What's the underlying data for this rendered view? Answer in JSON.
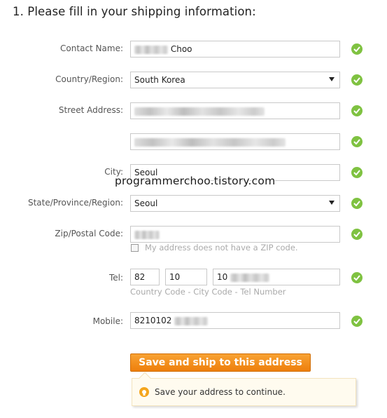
{
  "heading": "1. Please fill in your shipping information:",
  "form": {
    "contact_name": {
      "label": "Contact Name:",
      "value": "Choo"
    },
    "country": {
      "label": "Country/Region:",
      "value": "South Korea"
    },
    "street": {
      "label": "Street Address:"
    },
    "city": {
      "label": "City:",
      "value": "Seoul"
    },
    "state": {
      "label": "State/Province/Region:",
      "value": "Seoul"
    },
    "zip": {
      "label": "Zip/Postal Code:",
      "no_zip_label": "My address does not have a ZIP code."
    },
    "tel": {
      "label": "Tel:",
      "country_code": "82",
      "city_code": "10",
      "number": "10",
      "hint": "Country Code - City Code - Tel Number"
    },
    "mobile": {
      "label": "Mobile:",
      "value": "8210102"
    }
  },
  "watermark": "programmerchoo.tistory.com",
  "save_button": "Save and ship to this address",
  "notice": "Save your address to continue.",
  "icons": {
    "valid": "check-circle-icon",
    "dropdown": "chevron-down-icon",
    "notice": "lightbulb-icon"
  },
  "colors": {
    "accent": "#f18a1b",
    "valid": "#7fc241"
  }
}
